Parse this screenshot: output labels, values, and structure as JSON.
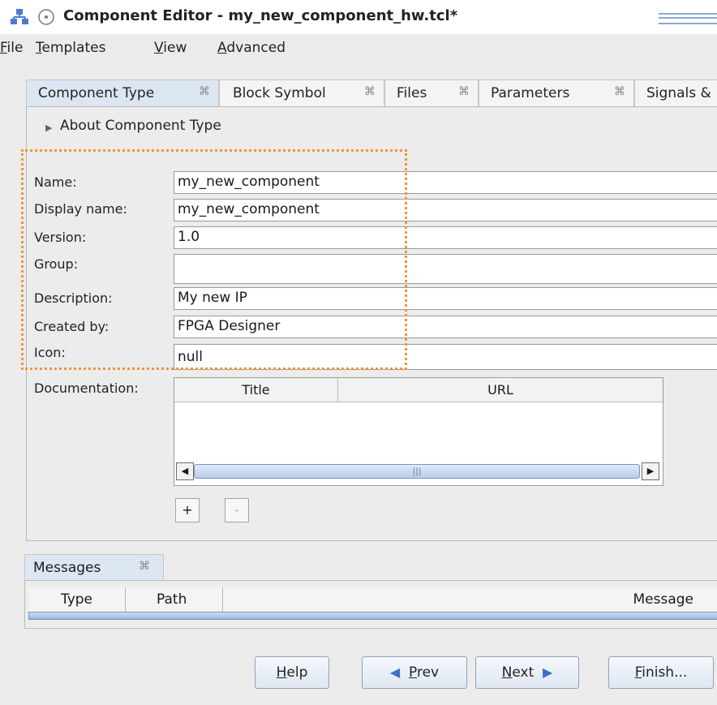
{
  "window": {
    "title": "Component Editor - my_new_component_hw.tcl*"
  },
  "menu": [
    {
      "mnemonic": "F",
      "rest": "ile"
    },
    {
      "mnemonic": "T",
      "rest": "emplates"
    },
    {
      "mnemonic": "V",
      "rest": "iew"
    },
    {
      "mnemonic": "A",
      "rest": "dvanced"
    }
  ],
  "tabs": [
    "Component Type",
    "Block Symbol",
    "Files",
    "Parameters",
    "Signals &"
  ],
  "about_section": "About Component Type",
  "form": {
    "name_label": "Name:",
    "name_value": "my_new_component",
    "display_label": "Display name:",
    "display_value": "my_new_component",
    "version_label": "Version:",
    "version_value": "1.0",
    "group_label": "Group:",
    "group_value": "",
    "description_label": "Description:",
    "description_value": "My new IP",
    "created_label": "Created by:",
    "created_value": "FPGA Designer",
    "icon_label": "Icon:",
    "icon_value": "null",
    "documentation_label": "Documentation:"
  },
  "doc_table": {
    "columns": [
      "Title",
      "URL"
    ]
  },
  "doc_buttons": {
    "add": "+",
    "remove": "-"
  },
  "messages": {
    "tab": "Messages",
    "columns": [
      "Type",
      "Path",
      "Message"
    ]
  },
  "footer": {
    "help": {
      "mnemonic": "H",
      "rest": "elp"
    },
    "prev": {
      "mnemonic": "P",
      "rest": "rev"
    },
    "next": {
      "mnemonic": "N",
      "rest": "ext"
    },
    "finish": {
      "mnemonic": "F",
      "rest": "inish..."
    }
  },
  "colors": {
    "accent": "#3d6fd0",
    "highlight_outline": "#f0953a",
    "active_tab": "#dde7f3"
  }
}
